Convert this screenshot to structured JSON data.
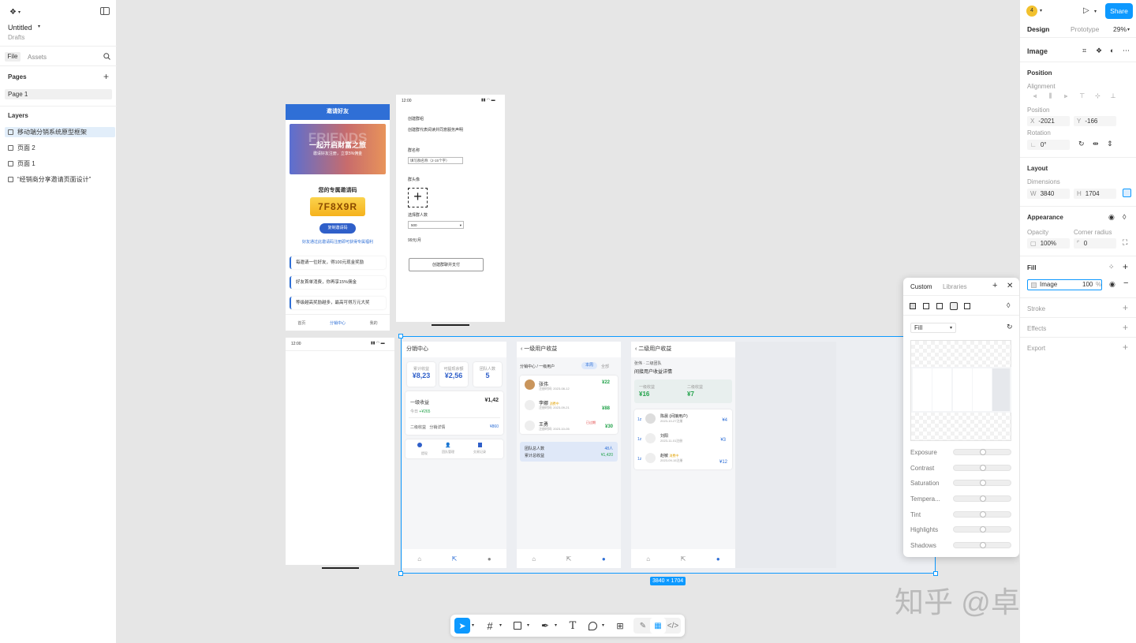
{
  "file": {
    "name": "Untitled",
    "location": "Drafts"
  },
  "left_tabs": {
    "file": "File",
    "assets": "Assets"
  },
  "pages": {
    "title": "Pages",
    "items": [
      "Page 1"
    ]
  },
  "layers": {
    "title": "Layers",
    "items": [
      "移动端分销系统原型框架",
      "页面 2",
      "页面 1",
      "“经销商分享邀请页面设计”"
    ]
  },
  "right_tabs": {
    "design": "Design",
    "prototype": "Prototype",
    "zoom": "29%"
  },
  "avatar": "4",
  "share": "Share",
  "props": {
    "title": "Image",
    "position": "Position",
    "alignment": "Alignment",
    "position_lbl": "Position",
    "x_key": "X",
    "x": "-2021",
    "y_key": "Y",
    "y": "-166",
    "rotation": "Rotation",
    "rot": "0°",
    "layout": "Layout",
    "dimensions": "Dimensions",
    "w_key": "W",
    "w": "3840",
    "h_key": "H",
    "h": "1704",
    "appearance": "Appearance",
    "opacity_lbl": "Opacity",
    "opacity": "100%",
    "radius_lbl": "Corner radius",
    "radius": "0",
    "fill": "Fill",
    "fill_type": "Image",
    "fill_val": "100",
    "fill_pct": "%",
    "stroke": "Stroke",
    "effects": "Effects",
    "export": "Export"
  },
  "popup": {
    "custom": "Custom",
    "libraries": "Libraries",
    "mode": "Fill",
    "sliders": [
      "Exposure",
      "Contrast",
      "Saturation",
      "Tempera...",
      "Tint",
      "Highlights",
      "Shadows"
    ]
  },
  "selection_size": "3840 × 1704",
  "watermark": "知乎 @卓伊凡",
  "help": "?",
  "invite": {
    "header": "邀请好友",
    "banner_big": "一起开启财富之旅",
    "banner_word": "FRIENDS",
    "banner_small": "邀请好友注册，立享5%佣金",
    "code_title": "您的专属邀请码",
    "code": "7F8X9R",
    "copy": "复制邀请码",
    "hint": "好友通过此邀请码注册即可获得专属福利",
    "rules": [
      "每邀请一位好友，得100元现金奖励",
      "好友首单消费，你再享15%佣金",
      "等级越高奖励越多，最高可得万元大奖"
    ],
    "nav": [
      "首页",
      "分销中心",
      "我的"
    ]
  },
  "group": {
    "time": "12:00",
    "title": "创建群组",
    "desc": "创建群代表阅读并同意服务声明",
    "name_lbl": "群名称",
    "name_ph": "填写群名称（2-15个字）",
    "avatar_lbl": "群头像",
    "count_lbl": "选择群人数",
    "count": "500",
    "price": "99元/月",
    "submit": "创建群聊并支付"
  },
  "blank": {
    "time": "12:00"
  },
  "dist": {
    "title": "分销中心",
    "stats": [
      {
        "l": "累计收益",
        "v": "¥8,23"
      },
      {
        "l": "可提现余额",
        "v": "¥2,56"
      },
      {
        "l": "团队人数",
        "v": "5"
      }
    ],
    "l1": "一级收益",
    "l1v": "¥1,42",
    "today": "今日",
    "todayv": "+¥265",
    "l2": "二级收益",
    "l2s": "分销详情",
    "l2v": "¥860",
    "icons": [
      "提现",
      "团队管理",
      "交易记录"
    ]
  },
  "u1": {
    "title": "一级用户收益",
    "crumb": "分销中心 / 一级用户",
    "tabs": [
      "本周",
      "全部"
    ],
    "users": [
      {
        "n": "张伟",
        "d": "注册时间: 2023-08-12",
        "v": "¥22",
        "tag": ""
      },
      {
        "n": "李娜",
        "d": "注册时间: 2023-09-21",
        "v": "¥88",
        "tag": "消费中"
      },
      {
        "n": "王勇",
        "d": "注册时间: 2023-10-05",
        "v": "¥30",
        "tag": "已过期"
      }
    ],
    "team": "团队总人数",
    "teamv": "48人",
    "total": "累计总收益",
    "totalv": "¥1,420"
  },
  "u2": {
    "title": "二级用户收益",
    "sub": "张伟 · 二级团队",
    "head": "间接用户收益详情",
    "c1": "一级收益",
    "c1v": "¥16",
    "c2": "二级收益",
    "c2v": "¥7",
    "users": [
      {
        "n": "陈晨 (间接用户)",
        "d": "2023-10-27注册",
        "v": "¥4"
      },
      {
        "n": "刘阳",
        "d": "2023-11-01注册",
        "v": "¥3"
      },
      {
        "n": "赵敏",
        "d": "2023-09-15注册",
        "v": "¥12",
        "tag": "消费中"
      }
    ]
  },
  "colors": {
    "accent": "#0d99ff",
    "brand_blue": "#2f6fd6",
    "code_yellow": "#f7c42b",
    "green": "#22a24a",
    "selection": "#0d99ff"
  }
}
